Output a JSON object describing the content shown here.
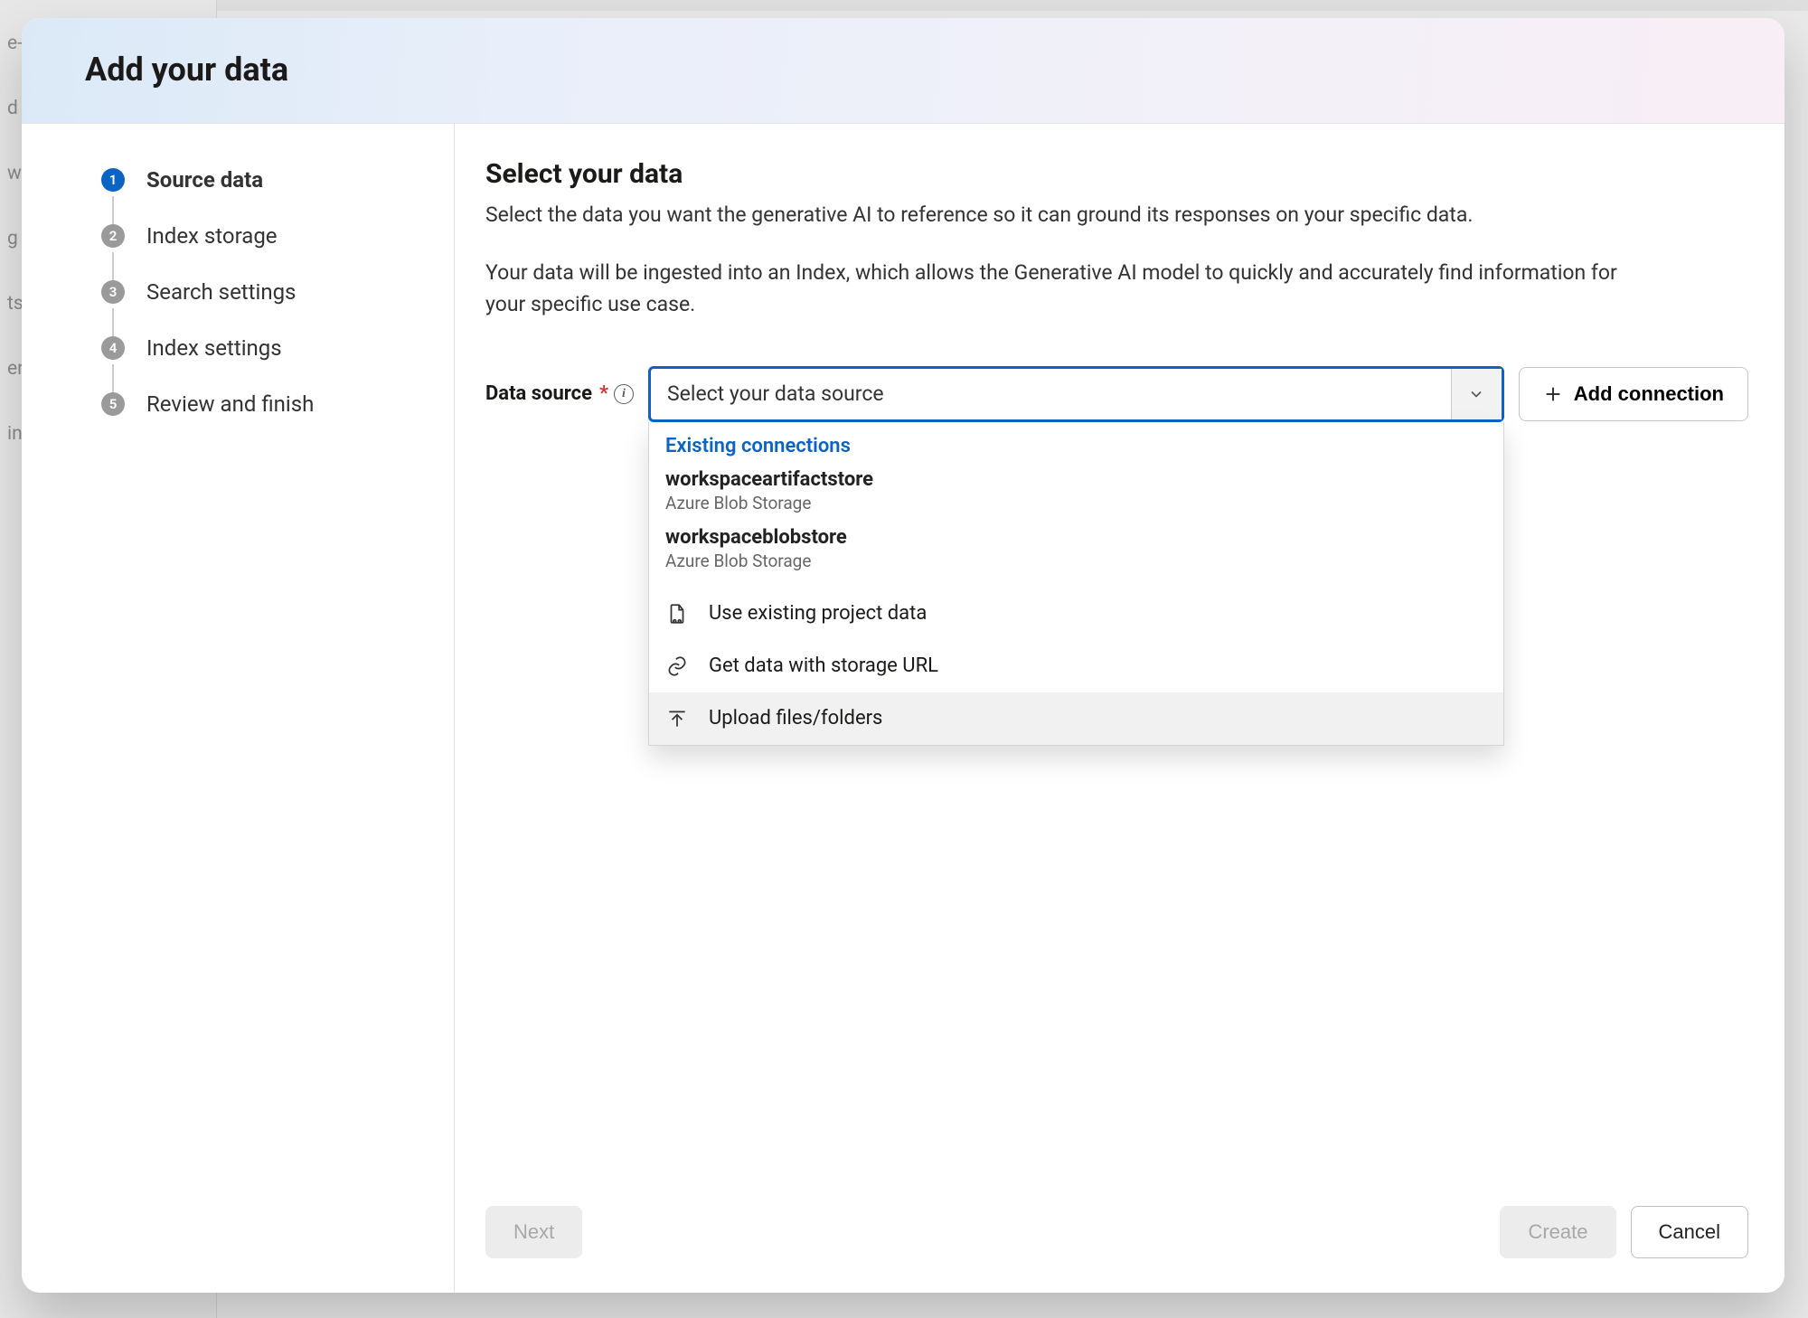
{
  "backdrop_nav": [
    "e-t",
    "d",
    "w",
    "g",
    "ts",
    "er",
    "in"
  ],
  "dialog": {
    "title": "Add your data"
  },
  "steps": [
    {
      "num": "1",
      "label": "Source data",
      "active": true
    },
    {
      "num": "2",
      "label": "Index storage",
      "active": false
    },
    {
      "num": "3",
      "label": "Search settings",
      "active": false
    },
    {
      "num": "4",
      "label": "Index settings",
      "active": false
    },
    {
      "num": "5",
      "label": "Review and finish",
      "active": false
    }
  ],
  "content": {
    "heading": "Select your data",
    "para1": "Select the data you want the generative AI to reference so it can ground its responses on your specific data.",
    "para2": "Your data will be ingested into an Index, which allows the Generative AI model to quickly and accurately find information for your specific use case."
  },
  "field": {
    "label": "Data source",
    "required_marker": "*",
    "info_tooltip": "i",
    "placeholder": "Select your data source",
    "add_connection_label": "Add connection"
  },
  "dropdown": {
    "section_title": "Existing connections",
    "connections": [
      {
        "name": "workspaceartifactstore",
        "type": "Azure Blob Storage"
      },
      {
        "name": "workspaceblobstore",
        "type": "Azure Blob Storage"
      }
    ],
    "actions": [
      {
        "icon": "file-data-icon",
        "label": "Use existing project data"
      },
      {
        "icon": "link-icon",
        "label": "Get data with storage URL"
      },
      {
        "icon": "upload-icon",
        "label": "Upload files/folders",
        "hovered": true
      }
    ]
  },
  "footer": {
    "next": "Next",
    "create": "Create",
    "cancel": "Cancel"
  }
}
